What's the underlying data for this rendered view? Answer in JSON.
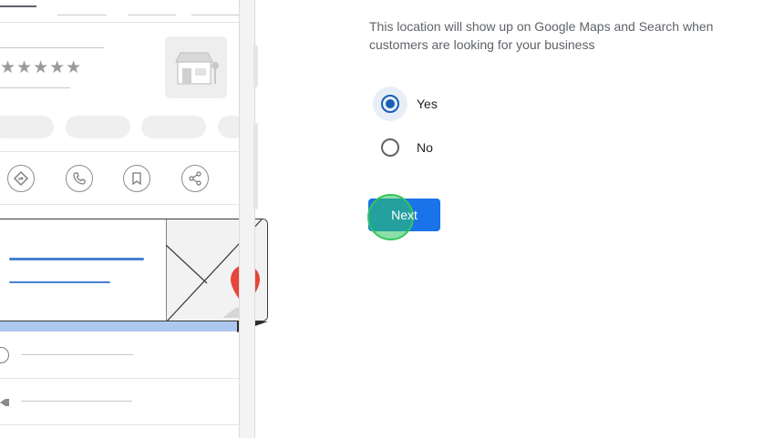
{
  "form": {
    "description": "This location will show up on Google Maps and Search when customers are looking for your business",
    "options": [
      {
        "label": "Yes",
        "selected": true
      },
      {
        "label": "No",
        "selected": false
      }
    ],
    "next_label": "Next"
  },
  "illustration": {
    "rating_stars": "★★★★★"
  },
  "colors": {
    "primary": "#1a73e8",
    "radio_selected": "#1a5fb4",
    "map_pin": "#e5453b",
    "click_indicator": "#34c759"
  }
}
